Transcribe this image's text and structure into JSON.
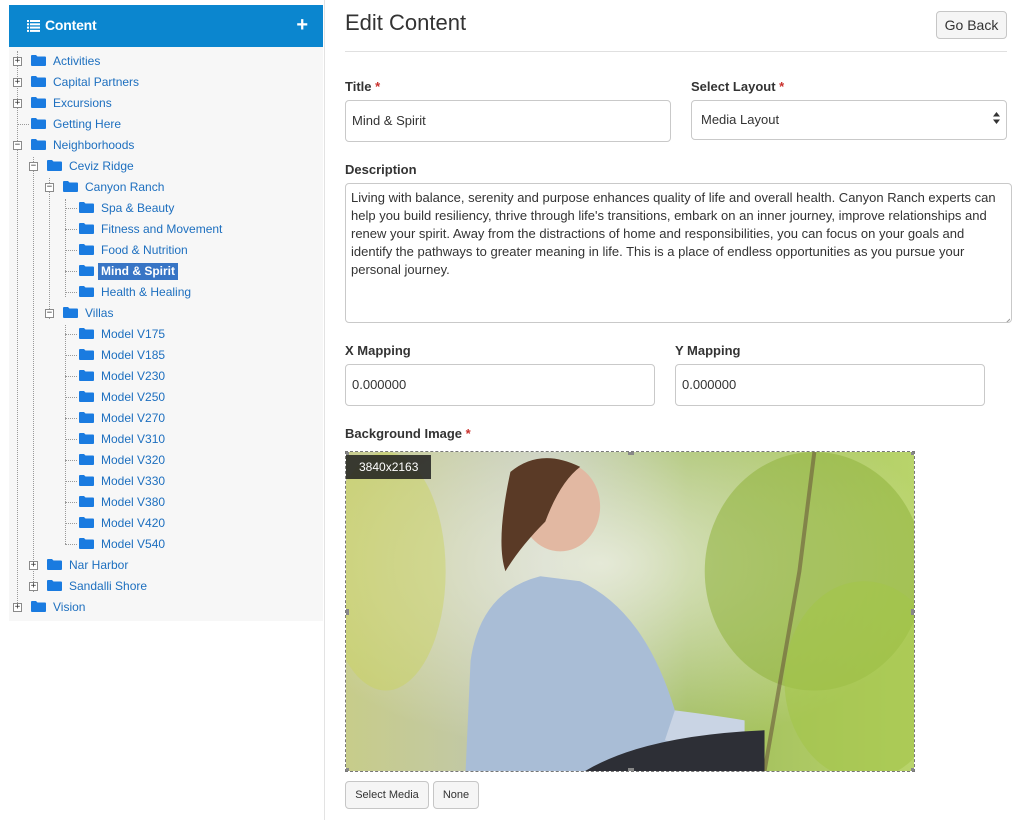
{
  "sidebar": {
    "title": "Content",
    "add_symbol": "+",
    "tree": {
      "activities": "Activities",
      "capital_partners": "Capital Partners",
      "excursions": "Excursions",
      "getting_here": "Getting Here",
      "neighborhoods": "Neighborhoods",
      "ceviz_ridge": "Ceviz Ridge",
      "canyon_ranch": "Canyon Ranch",
      "spa_beauty": "Spa & Beauty",
      "fitness_movement": "Fitness and Movement",
      "food_nutrition": "Food & Nutrition",
      "mind_spirit": "Mind & Spirit",
      "health_healing": "Health & Healing",
      "villas": "Villas",
      "v175": "Model V175",
      "v185": "Model V185",
      "v230": "Model V230",
      "v250": "Model V250",
      "v270": "Model V270",
      "v310": "Model V310",
      "v320": "Model V320",
      "v330": "Model V330",
      "v380": "Model V380",
      "v420": "Model V420",
      "v540": "Model V540",
      "nar_harbor": "Nar Harbor",
      "sandalli_shore": "Sandalli Shore",
      "vision": "Vision"
    },
    "expand_symbol": "+",
    "collapse_symbol": "−"
  },
  "main": {
    "page_title": "Edit Content",
    "go_back_label": "Go Back",
    "required_mark": "*",
    "title_label": "Title",
    "title_value": "Mind & Spirit",
    "layout_label": "Select Layout",
    "layout_value": "Media Layout",
    "description_label": "Description",
    "description_value": "Living with balance, serenity and purpose enhances quality of life and overall health. Canyon Ranch experts can help you build resiliency, thrive through life's transitions, embark on an inner journey, improve relationships and renew your spirit. Away from the distractions of home and responsibilities, you can focus on your goals and identify the pathways to greater meaning in life. This is a place of endless opportunities as you pursue your personal journey.",
    "x_mapping_label": "X Mapping",
    "x_mapping_value": "0.000000",
    "y_mapping_label": "Y Mapping",
    "y_mapping_value": "0.000000",
    "background_image_label": "Background Image",
    "image_dimensions": "3840x2163",
    "select_media_label": "Select Media",
    "none_label": "None"
  },
  "colors": {
    "header_blue": "#0b86cf",
    "link_blue": "#1d6fbf",
    "selected_bg": "#3875c5",
    "required_red": "#c9302c",
    "folder_blue": "#1a7be0"
  },
  "icons": {
    "list": "list-icon",
    "add": "plus-icon",
    "folder": "folder-icon"
  }
}
